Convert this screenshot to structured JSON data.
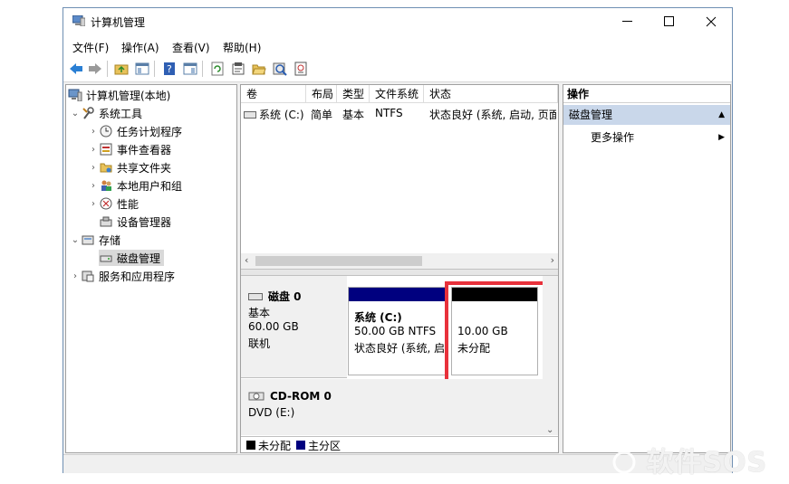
{
  "window": {
    "title": "计算机管理"
  },
  "menu": [
    "文件(F)",
    "操作(A)",
    "查看(V)",
    "帮助(H)"
  ],
  "toolbar_icons": [
    "back-arrow-icon",
    "forward-arrow-icon",
    "up-folder-icon",
    "show-tree-icon",
    "help-icon",
    "show-action-pane-icon",
    "refresh-icon",
    "properties-icon",
    "open-folder-icon",
    "rescan-icon",
    "disk-settings-icon"
  ],
  "tree": {
    "root": "计算机管理(本地)",
    "system_tools": "系统工具",
    "task_scheduler": "任务计划程序",
    "event_viewer": "事件查看器",
    "shared_folders": "共享文件夹",
    "local_users": "本地用户和组",
    "performance": "性能",
    "device_manager": "设备管理器",
    "storage": "存储",
    "disk_management": "磁盘管理",
    "services_apps": "服务和应用程序"
  },
  "volume_table": {
    "headers": [
      "卷",
      "布局",
      "类型",
      "文件系统",
      "状态"
    ],
    "rows": [
      {
        "volume": "系统 (C:)",
        "layout": "简单",
        "type": "基本",
        "fs": "NTFS",
        "status": "状态良好 (系统, 启动, 页面"
      }
    ]
  },
  "disk0": {
    "name": "磁盘 0",
    "type": "基本",
    "size": "60.00 GB",
    "state": "联机",
    "partition_c": {
      "name": "系统 (C:)",
      "size_fs": "50.00 GB NTFS",
      "status": "状态良好 (系统, 启"
    },
    "unallocated": {
      "size": "10.00 GB",
      "label": "未分配"
    }
  },
  "cdrom0": {
    "name": "CD-ROM 0",
    "drive": "DVD (E:)"
  },
  "legend": {
    "unallocated": "未分配",
    "primary": "主分区"
  },
  "actions": {
    "header": "操作",
    "section": "磁盘管理",
    "more": "更多操作"
  },
  "watermark": "软件SOS",
  "colors": {
    "primary_partition": "#00007f",
    "unallocated": "#000000",
    "highlight_box": "#e8313b",
    "action_section": "#c9d7ea"
  }
}
